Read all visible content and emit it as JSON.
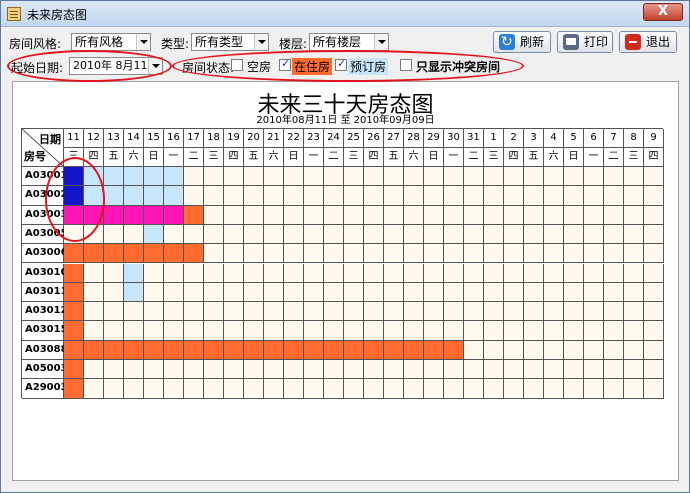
{
  "window": {
    "title": "未来房态图",
    "close_glyph": "X"
  },
  "filters": {
    "style_label": "房间风格:",
    "style_value": "所有风格",
    "type_label": "类型:",
    "type_value": "所有类型",
    "floor_label": "楼层:",
    "floor_value": "所有楼层",
    "start_label": "起始日期:",
    "start_value": "2010年  8月11日"
  },
  "toolbar": {
    "refresh_label": "刷新",
    "print_label": "打印",
    "exit_label": "退出"
  },
  "status": {
    "label": "房间状态:",
    "options": [
      {
        "label": "空房",
        "checked": false
      },
      {
        "label": "在住房",
        "checked": true
      },
      {
        "label": "预订房",
        "checked": true
      }
    ],
    "conflict_label": "只显示冲突房间",
    "conflict_checked": false
  },
  "colors": {
    "empty": "#fff9ee",
    "occupied": "#ff6a2e",
    "booked": "#c7e6fb",
    "selected": "#1414c8",
    "conflict": "#ff14b4",
    "highlight": "#e3141e"
  },
  "chart": {
    "title": "未来三十天房态图",
    "range": "2010年08月11日 至 2010年09月09日",
    "corner_date": "日期",
    "corner_room": "房号",
    "days": [
      "11",
      "12",
      "13",
      "14",
      "15",
      "16",
      "17",
      "18",
      "19",
      "20",
      "21",
      "22",
      "23",
      "24",
      "25",
      "26",
      "27",
      "28",
      "29",
      "30",
      "31",
      "1",
      "2",
      "3",
      "4",
      "5",
      "6",
      "7",
      "8",
      "9"
    ],
    "weekdays": [
      "三",
      "四",
      "五",
      "六",
      "日",
      "一",
      "二",
      "三",
      "四",
      "五",
      "六",
      "日",
      "一",
      "二",
      "三",
      "四",
      "五",
      "六",
      "日",
      "一",
      "二",
      "三",
      "四",
      "五",
      "六",
      "日",
      "一",
      "二",
      "三",
      "四"
    ],
    "legend_codes": {
      "E": "empty",
      "O": "occupied",
      "B": "booked",
      "S": "selected",
      "C": "conflict"
    },
    "rooms": [
      {
        "id": "A03001",
        "cells": "SBBBBBEEEEEEEEEEEEEEEEEEEEEEEE"
      },
      {
        "id": "A03002",
        "cells": "SBBBBBEEEEEEEEEEEEEEEEEEEEEEEE"
      },
      {
        "id": "A03003",
        "cells": "CCCCCCOEEEEEEEEEEEEEEEEEEEEEEE"
      },
      {
        "id": "A03005",
        "cells": "EEEEBEEEEEEEEEEEEEEEEEEEEEEEEE"
      },
      {
        "id": "A03006",
        "cells": "OOOOOOOEEEEEEEEEEEEEEEEEEEEEEE"
      },
      {
        "id": "A03010",
        "cells": "OEEBEEEEEEEEEEEEEEEEEEEEEEEEEE"
      },
      {
        "id": "A03011",
        "cells": "OEEBEEEEEEEEEEEEEEEEEEEEEEEEEE"
      },
      {
        "id": "A03012",
        "cells": "OEEEEEEEEEEEEEEEEEEEEEEEEEEEEE"
      },
      {
        "id": "A03015",
        "cells": "OEEEEEEEEEEEEEEEEEEEEEEEEEEEEE"
      },
      {
        "id": "A03088",
        "cells": "OOOOOOOOOOOOOOOOOOOOEEEEEEEEEE"
      },
      {
        "id": "A05003",
        "cells": "OEEEEEEEEEEEEEEEEEEEEEEEEEEEEE"
      },
      {
        "id": "A29003",
        "cells": "OEEEEEEEEEEEEEEEEEEEEEEEEEEEEE"
      }
    ]
  }
}
